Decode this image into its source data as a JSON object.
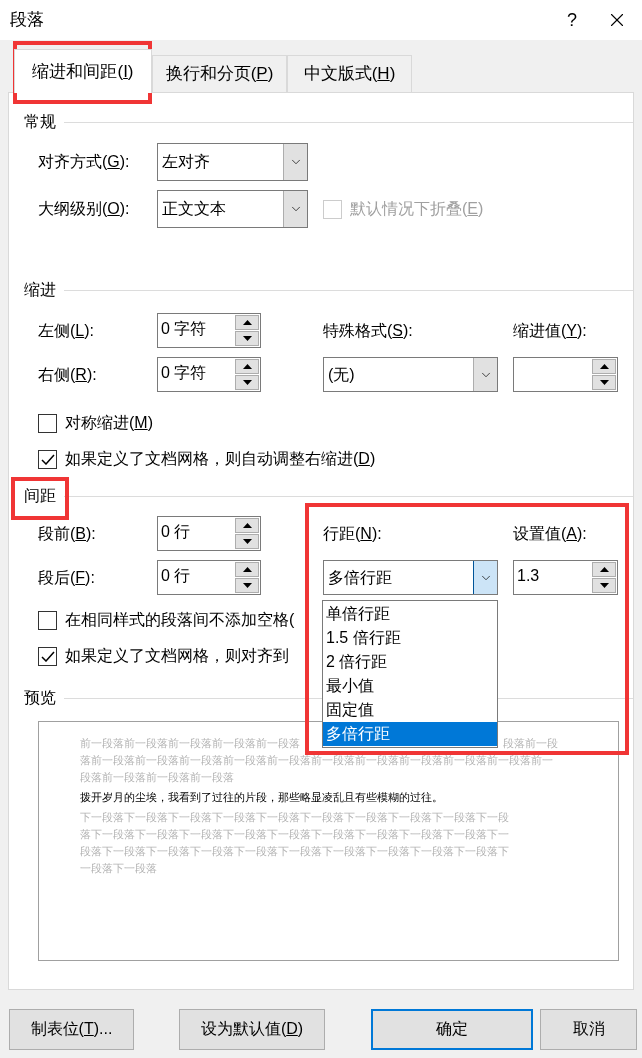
{
  "window": {
    "title": "段落",
    "help": "?"
  },
  "tabs": [
    {
      "label": "缩进和间距(I)",
      "selected": true
    },
    {
      "label": "换行和分页(P)",
      "selected": false
    },
    {
      "label": "中文版式(H)",
      "selected": false
    }
  ],
  "general": {
    "heading": "常规",
    "alignment": {
      "label": "对齐方式(G):",
      "value": "左对齐"
    },
    "outline_level": {
      "label": "大纲级别(O):",
      "value": "正文文本"
    },
    "collapse": {
      "label": "默认情况下折叠(E)",
      "checked": false,
      "disabled": true
    }
  },
  "indent": {
    "heading": "缩进",
    "left": {
      "label": "左侧(L):",
      "value": "0 字符"
    },
    "right": {
      "label": "右侧(R):",
      "value": "0 字符"
    },
    "special": {
      "label": "特殊格式(S):",
      "value": "(无)"
    },
    "by": {
      "label": "缩进值(Y):"
    },
    "checkboxes": [
      {
        "label": "对称缩进(M)",
        "checked": false
      },
      {
        "label": "如果定义了文档网格，则自动调整右缩进(D)",
        "checked": true
      }
    ]
  },
  "spacing": {
    "heading": "间距",
    "before": {
      "label": "段前(B):",
      "value": "0 行"
    },
    "after": {
      "label": "段后(F):",
      "value": "0 行"
    },
    "line_spacing": {
      "label": "行距(N):",
      "value": "多倍行距",
      "expanded": true,
      "options": [
        {
          "label": "单倍行距",
          "selected": false
        },
        {
          "label": "1.5 倍行距",
          "selected": false
        },
        {
          "label": "2 倍行距",
          "selected": false
        },
        {
          "label": "最小值",
          "selected": false
        },
        {
          "label": "固定值",
          "selected": false
        },
        {
          "label": "多倍行距",
          "selected": true
        }
      ]
    },
    "at": {
      "label": "设置值(A):",
      "value": "1.3"
    },
    "checkboxes": [
      {
        "label": "在相同样式的段落间不添加空格(",
        "checked": false
      },
      {
        "label": "如果定义了文档网格，则对齐到",
        "checked": true
      }
    ]
  },
  "preview": {
    "heading": "预览",
    "lines": [
      {
        "kind": "previous",
        "text": "前一段落前一段落前一段落前一段落前一段落",
        "tail": "段落前一段"
      },
      {
        "kind": "previous",
        "text": "落前一段落前一段落前一段落前一段落前一段落前一段落前一段落前一段落前一段落前一段落前一"
      },
      {
        "kind": "previous",
        "text": "段落前一段落前一段落前一段落"
      },
      {
        "kind": "current",
        "text": "拨开岁月的尘埃，我看到了过往的片段，那些略显凌乱且有些模糊的过往。"
      },
      {
        "kind": "next",
        "text": "下一段落下一段落下一段落下一段落下一段落下一段落下一段落下一段落下一段落下一段"
      },
      {
        "kind": "next",
        "text": "落下一段落下一段落下一段落下一段落下一段落下一段落下一段落下一段落下一段落下一"
      },
      {
        "kind": "next",
        "text": "段落下一段落下一段落下一段落下一段落下一段落下一段落下一段落下一段落下一段落下"
      },
      {
        "kind": "next",
        "text": "一段落下一段落"
      }
    ]
  },
  "buttons": [
    {
      "label": "制表位(T)...",
      "default": false
    },
    {
      "label": "设为默认值(D)",
      "default": false
    },
    {
      "label": "确定",
      "default": true
    },
    {
      "label": "取消",
      "default": false
    }
  ]
}
